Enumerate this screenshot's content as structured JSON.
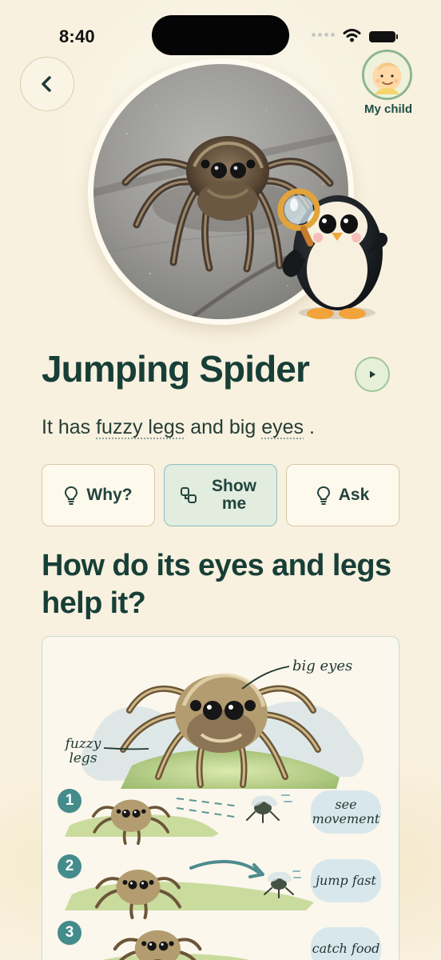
{
  "status_bar": {
    "time": "8:40"
  },
  "header": {
    "back_icon": "chevron-left-icon",
    "profile_label": "My child"
  },
  "hero": {
    "photo_alt": "jumping spider photo",
    "mascot_name": "penguin-mascot"
  },
  "main": {
    "title": "Jumping Spider",
    "description_parts": {
      "before": "It has ",
      "phrase_one": "fuzzy legs",
      "middle": " and big ",
      "phrase_two": "eyes",
      "after": "."
    },
    "actions": [
      {
        "label": "Why?",
        "icon": "lightbulb-icon"
      },
      {
        "label": "Show me",
        "icon": "show-me-icon"
      },
      {
        "label": "Ask",
        "icon": "lightbulb-icon"
      }
    ],
    "question": "How do its eyes and legs help it?"
  },
  "illustration": {
    "labels": {
      "big_eyes": "big eyes",
      "fuzzy_legs": "fuzzy legs"
    },
    "steps": [
      {
        "number": "1",
        "label": "see movement"
      },
      {
        "number": "2",
        "label": "jump fast"
      },
      {
        "number": "3",
        "label": "catch food"
      }
    ]
  },
  "colors": {
    "background": "#f8f1df",
    "heading": "#173f37",
    "accent": "#448b8c",
    "selected_button": "#e2ecdf"
  }
}
